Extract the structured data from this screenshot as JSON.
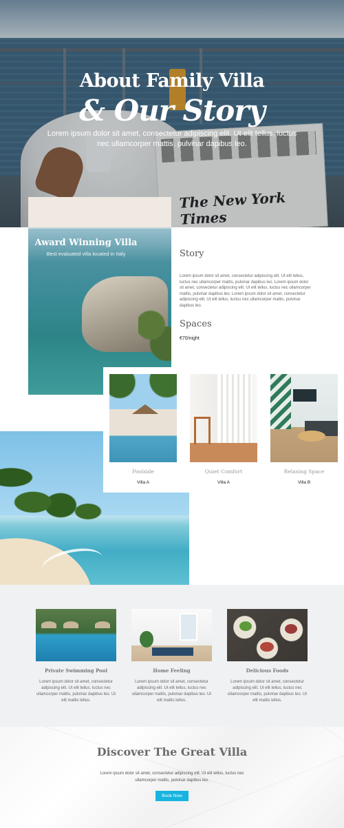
{
  "hero": {
    "title_line1": "About Family Villa",
    "title_line2": "& Our Story",
    "subtitle": "Lorem ipsum dolor sit amet, consectetur adipiscing elit. Ut elit tellus, luctus nec ullamcorper mattis, pulvinar dapibus leo."
  },
  "award": {
    "title": "Award Winning Villa",
    "subtitle": "Best evaluated villa located in Italy"
  },
  "story": {
    "title": "Story",
    "text": "Lorem ipsum dolor sit amet, consectetur adipiscing elit. Ut elit tellus, luctus nec ullamcorper mattis, pulvinar dapibus leo. Lorem ipsum dolor sit amet, consectetur adipiscing elit. Ut elit tellus, luctus nec ullamcorper mattis, pulvinar dapibus leo. Lorem ipsum dolor sit amet, consectetur adipiscing elit. Ut elit tellus, luctus nec ullamcorper mattis, pulvinar dapibus leo."
  },
  "spaces": {
    "title": "Spaces",
    "price": "€70/night",
    "rooms": [
      {
        "name": "Poolside",
        "villa": "Villa A"
      },
      {
        "name": "Quiet Comfort",
        "villa": "Villa A"
      },
      {
        "name": "Relaxing Space",
        "villa": "Villa B"
      }
    ]
  },
  "features": [
    {
      "title": "Private Swimming Pool",
      "text": "Lorem ipsum dolor sit amet, consectetur adipiscing elit. Ut elit tellus, luctus nec ullamcorper mattis, pulvinar dapibus leo. Ut elit mattis tellus."
    },
    {
      "title": "Home Feeling",
      "text": "Lorem ipsum dolor sit amet, consectetur adipiscing elit. Ut elit tellus, luctus nec ullamcorper mattis, pulvinar dapibus leo. Ut elit mattis tellus."
    },
    {
      "title": "Delicious Foods",
      "text": "Lorem ipsum dolor sit amet, consectetur adipiscing elit. Ut elit tellus, luctus nec ullamcorper mattis, pulvinar dapibus leo. Ut elit mattis tellus."
    }
  ],
  "discover": {
    "title": "Discover The Great Villa",
    "text": "Lorem ipsum dolor sit amet, consectetur adipiscing elit. Ut elit tellus, luctus nec ullamcorper mattis, pulvinar dapibus leo.",
    "button_label": "Book Now"
  },
  "colors": {
    "accent": "#17b4e0",
    "section_bg": "#f0f1f3"
  }
}
